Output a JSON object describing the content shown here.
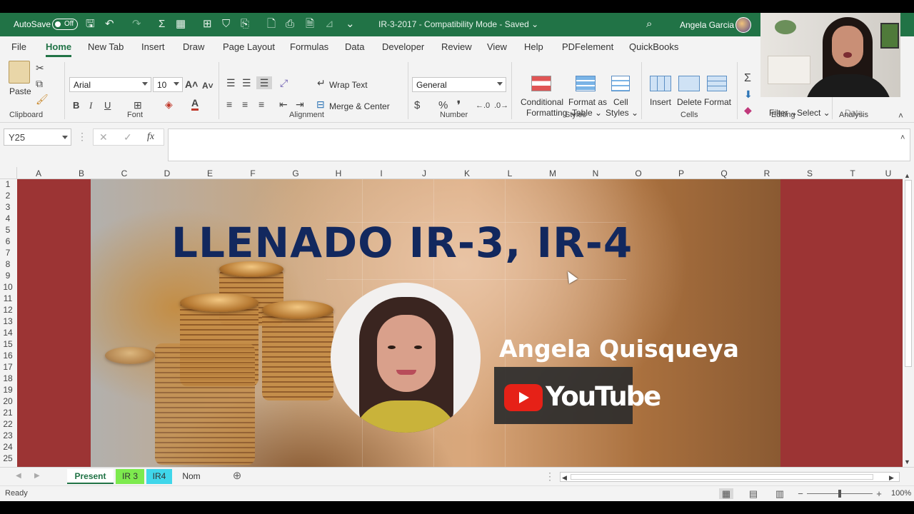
{
  "titlebar": {
    "autosave_label": "AutoSave",
    "autosave_state": "Off",
    "doc_title": "IR-3-2017  -  Compatibility Mode  -  Saved  ⌄",
    "user_name": "Angela Garcia"
  },
  "tabs": [
    "File",
    "Home",
    "New Tab",
    "Insert",
    "Draw",
    "Page Layout",
    "Formulas",
    "Data",
    "Developer",
    "Review",
    "View",
    "Help",
    "PDFelement",
    "QuickBooks"
  ],
  "active_tab": "Home",
  "ribbon": {
    "clipboard": {
      "paste": "Paste",
      "label": "Clipboard"
    },
    "font": {
      "name": "Arial",
      "size": "10",
      "bold": "B",
      "italic": "I",
      "underline": "U",
      "label": "Font"
    },
    "alignment": {
      "wrap": "Wrap Text",
      "merge": "Merge & Center",
      "label": "Alignment"
    },
    "number": {
      "format": "General",
      "currency": "$",
      "percent": "%",
      "comma": "❜",
      "label": "Number"
    },
    "styles": {
      "conditional_1": "Conditional",
      "conditional_2": "Formatting ⌄",
      "format_table_1": "Format as",
      "format_table_2": "Table ⌄",
      "cell_styles_1": "Cell",
      "cell_styles_2": "Styles ⌄",
      "label": "Styles"
    },
    "cells": {
      "insert": "Insert",
      "delete": "Delete",
      "format": "Format",
      "label": "Cells"
    },
    "editing": {
      "filter": "Filter ⌄",
      "select": "Select ⌄",
      "label": "Editing"
    },
    "analysis": {
      "data": "Data",
      "label": "Analysis"
    }
  },
  "formula_bar": {
    "name_box": "Y25",
    "fx": "fx",
    "cancel": "✕",
    "enter": "✓",
    "value": ""
  },
  "columns": [
    "A",
    "B",
    "C",
    "D",
    "E",
    "F",
    "G",
    "H",
    "I",
    "J",
    "K",
    "L",
    "M",
    "N",
    "O",
    "P",
    "Q",
    "R",
    "S",
    "T",
    "U"
  ],
  "rows": [
    "1",
    "2",
    "3",
    "4",
    "5",
    "6",
    "7",
    "8",
    "9",
    "10",
    "11",
    "12",
    "13",
    "14",
    "15",
    "16",
    "17",
    "18",
    "19",
    "20",
    "21",
    "22",
    "23",
    "24",
    "25"
  ],
  "banner": {
    "title": "LLENADO IR-3, IR-4",
    "author": "Angela Quisqueya",
    "youtube": "YouTube"
  },
  "sheet_tabs": [
    {
      "name": "Present",
      "color": "#ffffff",
      "active": true
    },
    {
      "name": "IR 3",
      "color": "#7dea4e",
      "active": false
    },
    {
      "name": "IR4",
      "color": "#3fd6ea",
      "active": false
    },
    {
      "name": "Nom",
      "color": "#f3f3f3",
      "active": false
    }
  ],
  "status": {
    "ready": "Ready",
    "zoom": "100%"
  },
  "colors": {
    "excel_green": "#217346",
    "sheet_fill": "#9c3434",
    "title_navy": "#12285e",
    "youtube_red": "#e62117"
  }
}
